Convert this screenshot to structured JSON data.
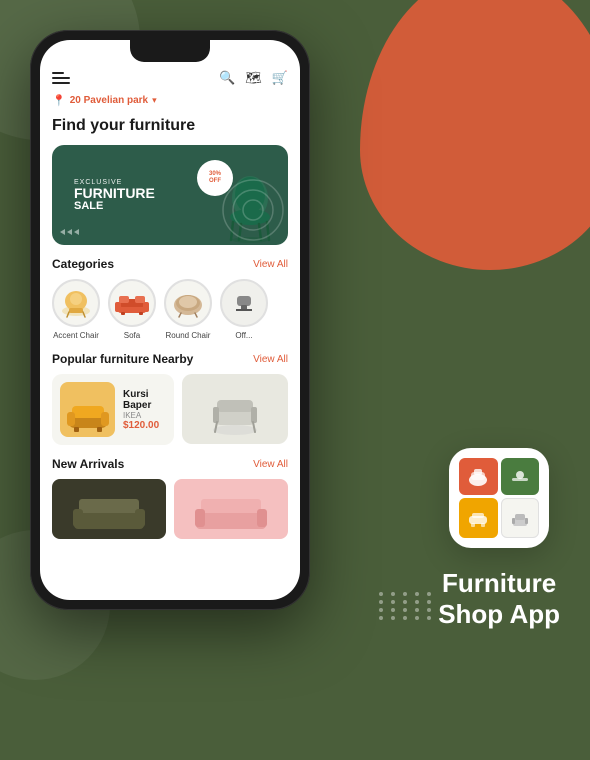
{
  "background": {
    "color": "#4a5e3a"
  },
  "app_icon": {
    "cells": [
      {
        "color": "orange",
        "icon": "🪑"
      },
      {
        "color": "green",
        "icon": "🌿"
      },
      {
        "color": "yellow",
        "icon": "🛋"
      },
      {
        "color": "white",
        "icon": "🪑"
      }
    ]
  },
  "app_title_line1": "Furniture",
  "app_title_line2": "Shop App",
  "phone": {
    "top_bar": {
      "search_icon": "🔍",
      "map_icon": "🗺",
      "cart_icon": "🛒"
    },
    "location": {
      "icon": "📍",
      "text": "20 Pavelian park",
      "arrow": "▾"
    },
    "page_title": "Find your furniture",
    "banner": {
      "exclusive": "EXCLUSIVE",
      "furniture": "FURNITURE",
      "sale": "SALE",
      "badge_top": "30%",
      "badge_bottom": "OFF",
      "arrows": [
        "▷",
        "▷",
        "▷"
      ]
    },
    "categories": {
      "title": "Categories",
      "view_all": "View All",
      "items": [
        {
          "label": "Accent Chair",
          "color": "#f0c060"
        },
        {
          "label": "Sofa",
          "color": "#e05c3a"
        },
        {
          "label": "Round Chair",
          "color": "#d4b896"
        },
        {
          "label": "Off...",
          "color": "#888"
        }
      ]
    },
    "popular": {
      "title": "Popular furniture Nearby",
      "view_all": "View All",
      "card": {
        "name": "Kursi Baper",
        "brand": "IKEA",
        "price": "$120.00",
        "img_color": "#f0a820"
      }
    },
    "new_arrivals": {
      "title": "New Arrivals",
      "view_all": "View All"
    }
  }
}
